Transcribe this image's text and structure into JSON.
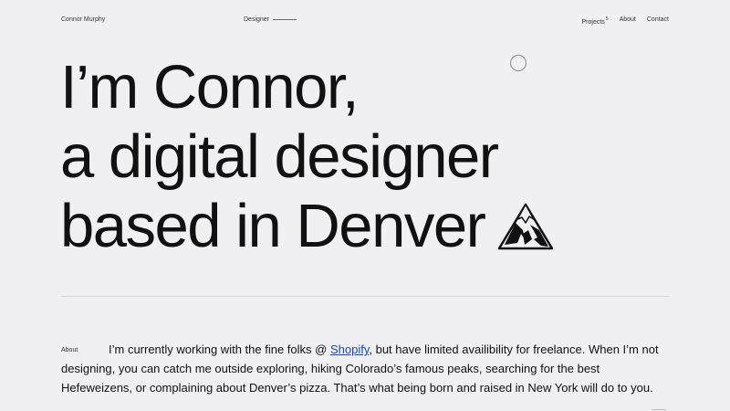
{
  "header": {
    "brand": "Connor Murphy",
    "role": "Designer",
    "nav": [
      {
        "label": "Projects",
        "count": "5"
      },
      {
        "label": "About"
      },
      {
        "label": "Contact"
      }
    ]
  },
  "hero": {
    "line1": "I’m Connor,",
    "line2": "a digital designer",
    "line3": "based in Denver",
    "icon": "mountain-icon"
  },
  "about": {
    "label": "About",
    "text_before": "I’m currently working with the fine folks @ ",
    "link": "Shopify",
    "text_after": ", but have limited availibility for freelance. When I’m not designing, you can catch me outside exploring, hiking Colorado’s famous peaks, searching for the best Hefeweizens, or complaining about Denver’s pizza. That’s what being born and raised in New York will do to you."
  },
  "colors": {
    "background": "#f0f0f2",
    "text": "#111111",
    "link": "#1a44c8"
  }
}
